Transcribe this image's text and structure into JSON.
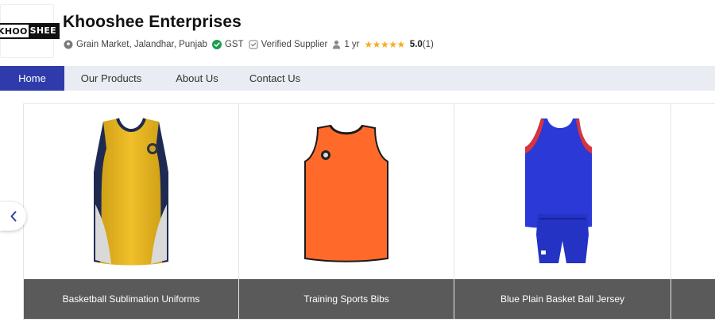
{
  "company": {
    "logo_left": "KHOO",
    "logo_right": "SHEE",
    "name": "Khooshee Enterprises",
    "location": "Grain Market, Jalandhar, Punjab",
    "gst": "GST",
    "verified": "Verified Supplier",
    "tenure": "1 yr",
    "stars": "★★★★★",
    "rating": "5.0",
    "rating_count": "(1)"
  },
  "nav": {
    "home": "Home",
    "products": "Our Products",
    "about": "About Us",
    "contact": "Contact Us"
  },
  "products": [
    {
      "title": "Basketball Sublimation Uniforms"
    },
    {
      "title": "Training Sports Bibs"
    },
    {
      "title": "Blue Plain Basket Ball Jersey"
    }
  ],
  "colors": {
    "nav_active": "#2f3bab",
    "nav_bg": "#e9ecf3",
    "caption_bg": "#5a5a5a",
    "star": "#f2b01e",
    "gst_check": "#1a9d4f"
  },
  "icons": {
    "location": "map-pin-icon",
    "gst": "check-circle-icon",
    "verified": "verified-badge-icon",
    "tenure": "person-icon",
    "prev": "chevron-left-icon"
  }
}
